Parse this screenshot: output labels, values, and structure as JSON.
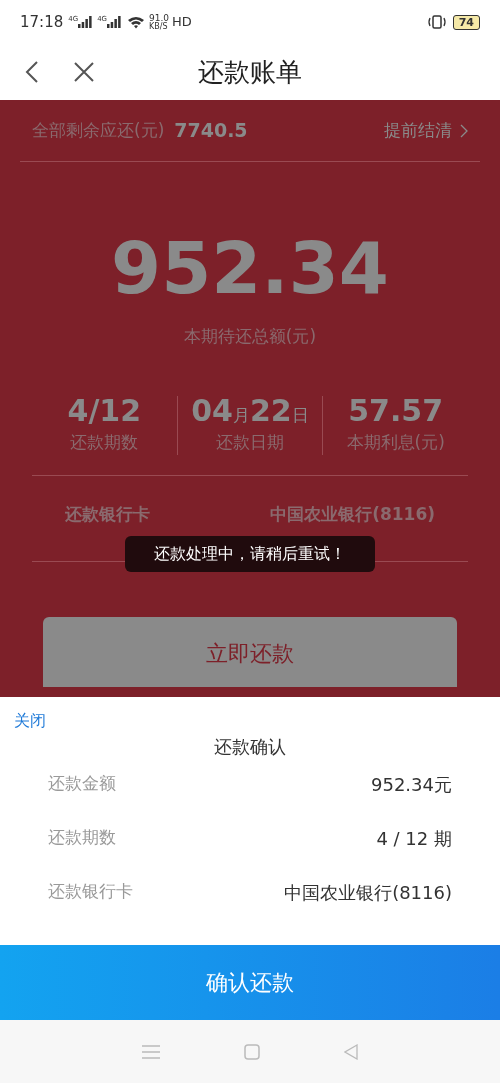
{
  "status_bar": {
    "time": "17:18",
    "sims": [
      "4G",
      "4G"
    ],
    "speed": "91.0",
    "speed_unit": "KB/S",
    "hd": "HD",
    "battery": "74"
  },
  "header": {
    "title": "还款账单"
  },
  "bill": {
    "remaining_label": "全部剩余应还(元)",
    "remaining_value": "7740.5",
    "settle_link": "提前结清",
    "amount": "952.34",
    "amount_label": "本期待还总额(元)",
    "stats": [
      {
        "kind": "plain",
        "value": "4/12",
        "label": "还款期数"
      },
      {
        "kind": "date",
        "month": "04",
        "month_unit": "月",
        "day": "22",
        "day_unit": "日",
        "label": "还款日期"
      },
      {
        "kind": "plain",
        "value": "57.57",
        "label": "本期利息(元)"
      }
    ],
    "card_label": "还款银行卡",
    "card_value": "中国农业银行(8116)",
    "pay_button": "立即还款"
  },
  "toast": "还款处理中，请稍后重试！",
  "sheet": {
    "close": "关闭",
    "title": "还款确认",
    "rows": [
      {
        "label": "还款金额",
        "value": "952.34元"
      },
      {
        "label": "还款期数",
        "value": "4 / 12 期"
      },
      {
        "label": "还款银行卡",
        "value": "中国农业银行(8116)"
      }
    ],
    "confirm": "确认还款"
  }
}
